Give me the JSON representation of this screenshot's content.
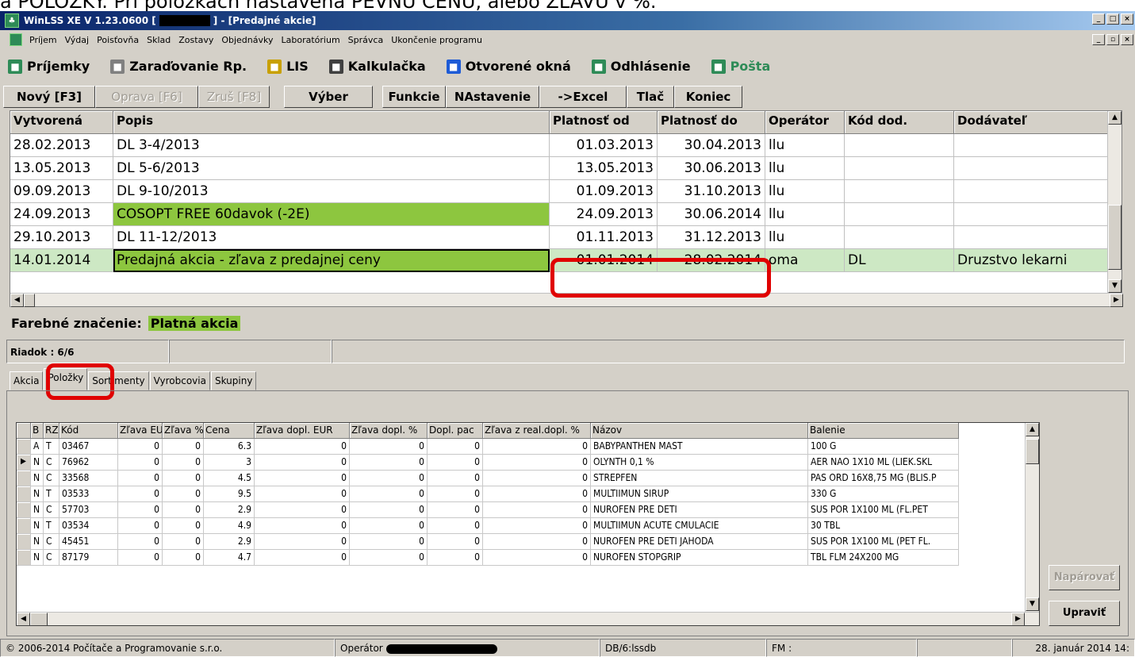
{
  "top_text": "a POLOŽKY. Pri položkách nastavená PEVNÚ CENU, alebo ZĽAVU v %.",
  "window": {
    "title": "WinLSS XE V 1.23.0600 [",
    "title_suffix": "] - [Predajné akcie]"
  },
  "menu": [
    "Príjem",
    "Výdaj",
    "Poisťovňa",
    "Sklad",
    "Zostavy",
    "Objednávky",
    "Laboratórium",
    "Správca",
    "Ukončenie programu"
  ],
  "toolbar": [
    {
      "label": "Príjemky",
      "icon": "receipt-icon",
      "color": "#2e8b57"
    },
    {
      "label": "Zaraďovanie Rp.",
      "icon": "prescription-icon",
      "color": "#808080"
    },
    {
      "label": "LIS",
      "icon": "link-icon",
      "color": "#c8a000"
    },
    {
      "label": "Kalkulačka",
      "icon": "calculator-icon",
      "color": "#404040"
    },
    {
      "label": "Otvorené okná",
      "icon": "windows-icon",
      "color": "#1e5bd6"
    },
    {
      "label": "Odhlásenie",
      "icon": "logout-icon",
      "color": "#2e8b57"
    },
    {
      "label": "Pošta",
      "icon": "mail-icon",
      "color": "#2e8b57"
    }
  ],
  "buttons": [
    {
      "label": "Nový [F3]",
      "disabled": false
    },
    {
      "label": "Oprava [F6]",
      "disabled": true
    },
    {
      "label": "Zruš [F8]",
      "disabled": true
    },
    {
      "label": "Výber",
      "disabled": false
    },
    {
      "label": "Funkcie",
      "disabled": false
    },
    {
      "label": "NAstavenie",
      "disabled": false
    },
    {
      "label": "->Excel",
      "disabled": false
    },
    {
      "label": "Tlač",
      "disabled": false
    },
    {
      "label": "Koniec",
      "disabled": false
    }
  ],
  "main_grid": {
    "columns": [
      "Vytvorená",
      "Popis",
      "Platnosť od",
      "Platnosť do",
      "Operátor",
      "Kód dod.",
      "Dodávateľ"
    ],
    "rows": [
      [
        "28.02.2013",
        "DL 3-4/2013",
        "01.03.2013",
        "30.04.2013",
        "llu",
        "",
        ""
      ],
      [
        "13.05.2013",
        "DL 5-6/2013",
        "13.05.2013",
        "30.06.2013",
        "llu",
        "",
        ""
      ],
      [
        "09.09.2013",
        "DL 9-10/2013",
        "01.09.2013",
        "31.10.2013",
        "llu",
        "",
        ""
      ],
      [
        "24.09.2013",
        "COSOPT FREE 60davok (-2E)",
        "24.09.2013",
        "30.06.2014",
        "llu",
        "",
        ""
      ],
      [
        "29.10.2013",
        "DL 11-12/2013",
        "01.11.2013",
        "31.12.2013",
        "llu",
        "",
        ""
      ],
      [
        "14.01.2014",
        "Predajná akcia - zľava z predajnej ceny",
        "01.01.2014",
        "28.02.2014",
        "oma",
        "DL",
        "Druzstvo lekarni"
      ]
    ],
    "highlight_color": "#8dc63f"
  },
  "legend": {
    "label": "Farebné značenie:",
    "value": "Platná akcia"
  },
  "riadok": "Riadok : 6/6",
  "tabs": [
    "Akcia",
    "Položky",
    "Sortimenty",
    "Vyrobcovia",
    "Skupiny"
  ],
  "items_grid": {
    "columns": [
      "B",
      "RZP",
      "Kód",
      "Zľava EUR",
      "Zľava %",
      "Cena",
      "Zľava dopl. EUR",
      "Zľava dopl. %",
      "Dopl. pac",
      "Zľava z real.dopl. %",
      "Názov",
      "Balenie"
    ],
    "rows": [
      [
        "A",
        "T",
        "03467",
        "0",
        "0",
        "6.3",
        "0",
        "0",
        "0",
        "0",
        "BABYPANTHEN MAST",
        "100 G"
      ],
      [
        "N",
        "C",
        "76962",
        "0",
        "0",
        "3",
        "0",
        "0",
        "0",
        "0",
        "OLYNTH 0,1 %",
        "AER NAO 1X10 ML (LIEK.SKL"
      ],
      [
        "N",
        "C",
        "33568",
        "0",
        "0",
        "4.5",
        "0",
        "0",
        "0",
        "0",
        "STREPFEN",
        "PAS ORD 16X8,75 MG (BLIS.P"
      ],
      [
        "N",
        "T",
        "03533",
        "0",
        "0",
        "9.5",
        "0",
        "0",
        "0",
        "0",
        "MULTIIMUN SIRUP",
        "330 G"
      ],
      [
        "N",
        "C",
        "57703",
        "0",
        "0",
        "2.9",
        "0",
        "0",
        "0",
        "0",
        "NUROFEN PRE DETI",
        "SUS POR 1X100 ML (FL.PET"
      ],
      [
        "N",
        "T",
        "03534",
        "0",
        "0",
        "4.9",
        "0",
        "0",
        "0",
        "0",
        "MULTIIMUN ACUTE CMULACIE",
        "30 TBL"
      ],
      [
        "N",
        "C",
        "45451",
        "0",
        "0",
        "2.9",
        "0",
        "0",
        "0",
        "0",
        "NUROFEN PRE DETI JAHODA",
        "SUS POR 1X100 ML (PET FL."
      ],
      [
        "N",
        "C",
        "87179",
        "0",
        "0",
        "4.7",
        "0",
        "0",
        "0",
        "0",
        "NUROFEN STOPGRIP",
        "TBL FLM 24X200 MG"
      ]
    ]
  },
  "side_buttons": {
    "pair": "Napárovať",
    "edit": "Upraviť"
  },
  "statusbar": {
    "copyright": "© 2006-2014 Počítače a Programovanie s.r.o.",
    "operator": "Operátor",
    "db": "DB/6:lssdb",
    "fm": "FM :",
    "date": "28. január 2014 14:"
  }
}
